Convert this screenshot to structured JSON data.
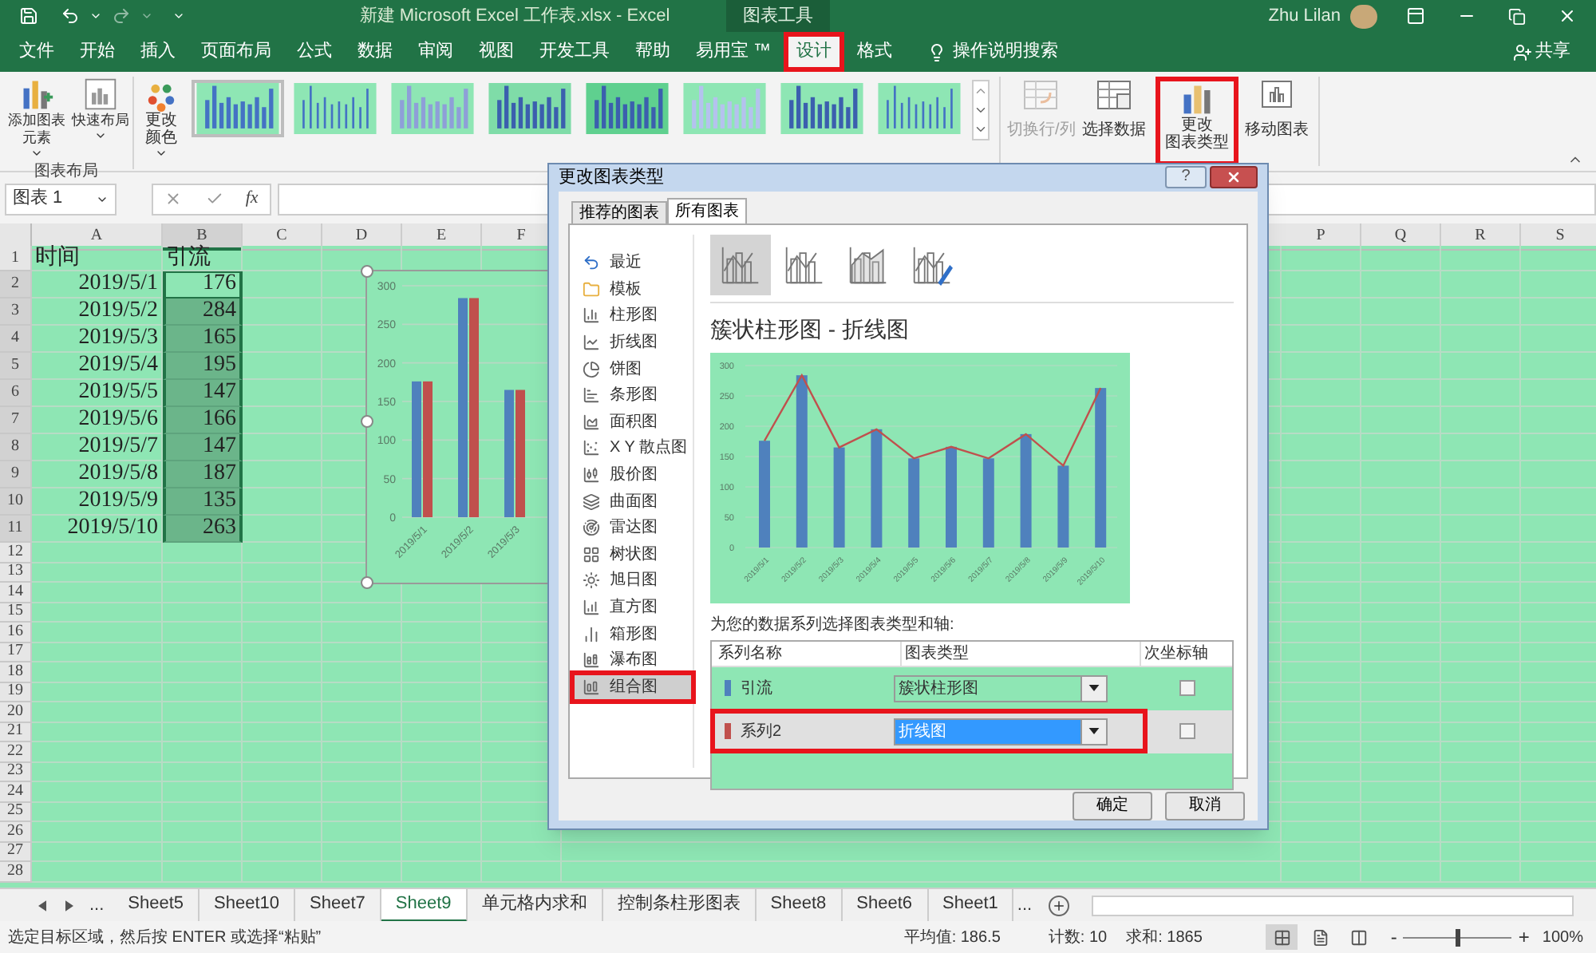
{
  "title_bar": {
    "title": "新建 Microsoft Excel 工作表.xlsx  -  Excel",
    "context": "图表工具",
    "user": "Zhu Lilan"
  },
  "menu": {
    "tabs": [
      {
        "label": "文件",
        "selected": false,
        "annotated": false
      },
      {
        "label": "开始",
        "selected": false,
        "annotated": false
      },
      {
        "label": "插入",
        "selected": false,
        "annotated": false
      },
      {
        "label": "页面布局",
        "selected": false,
        "annotated": false
      },
      {
        "label": "公式",
        "selected": false,
        "annotated": false
      },
      {
        "label": "数据",
        "selected": false,
        "annotated": false
      },
      {
        "label": "审阅",
        "selected": false,
        "annotated": false
      },
      {
        "label": "视图",
        "selected": false,
        "annotated": false
      },
      {
        "label": "开发工具",
        "selected": false,
        "annotated": false
      },
      {
        "label": "帮助",
        "selected": false,
        "annotated": false
      },
      {
        "label": "易用宝 ™",
        "selected": false,
        "annotated": false
      },
      {
        "label": "设计",
        "selected": true,
        "annotated": true
      },
      {
        "label": "格式",
        "selected": false,
        "annotated": false
      }
    ],
    "search": "操作说明搜索",
    "share": "共享"
  },
  "ribbon": {
    "layout_buttons": [
      {
        "lines": [
          "添加图表",
          "元素"
        ],
        "dropdown": true
      },
      {
        "lines": [
          "快速布局"
        ],
        "dropdown": true
      }
    ],
    "layout_group": "图表布局",
    "color_button": {
      "lines": [
        "更改",
        "颜色"
      ],
      "dropdown": true
    },
    "chart_styles": [
      {
        "selected": true
      },
      {
        "selected": false
      },
      {
        "selected": false
      },
      {
        "selected": false
      },
      {
        "selected": false
      },
      {
        "selected": false
      },
      {
        "selected": false
      },
      {
        "selected": false
      }
    ],
    "data_buttons": [
      {
        "label": "切换行/列",
        "disabled": true
      },
      {
        "label": "选择数据",
        "disabled": false
      }
    ],
    "change_type": {
      "lines": [
        "更改",
        "图表类型"
      ],
      "annotated": true
    },
    "move_chart": "移动图表"
  },
  "formula_bar": {
    "name_box": "图表 1",
    "fx": "fx"
  },
  "sheet": {
    "columns_left": [
      {
        "label": "A",
        "selected": false
      },
      {
        "label": "B",
        "selected": true
      },
      {
        "label": "C",
        "selected": false
      },
      {
        "label": "D",
        "selected": false
      },
      {
        "label": "E",
        "selected": false
      },
      {
        "label": "F",
        "selected": false
      }
    ],
    "columns_right": [
      {
        "label": "P",
        "selected": false
      },
      {
        "label": "Q",
        "selected": false
      },
      {
        "label": "R",
        "selected": false
      },
      {
        "label": "S",
        "selected": false
      }
    ],
    "rows": [
      {
        "header": "1",
        "a": "时间",
        "b": "引流",
        "b_selected": false,
        "active": false
      },
      {
        "header": "2",
        "a": "2019/5/1",
        "b": "176",
        "b_selected": true,
        "active": true
      },
      {
        "header": "3",
        "a": "2019/5/2",
        "b": "284",
        "b_selected": true,
        "active": false
      },
      {
        "header": "4",
        "a": "2019/5/3",
        "b": "165",
        "b_selected": true,
        "active": false
      },
      {
        "header": "5",
        "a": "2019/5/4",
        "b": "195",
        "b_selected": true,
        "active": false
      },
      {
        "header": "6",
        "a": "2019/5/5",
        "b": "147",
        "b_selected": true,
        "active": false
      },
      {
        "header": "7",
        "a": "2019/5/6",
        "b": "166",
        "b_selected": true,
        "active": false
      },
      {
        "header": "8",
        "a": "2019/5/7",
        "b": "147",
        "b_selected": true,
        "active": false
      },
      {
        "header": "9",
        "a": "2019/5/8",
        "b": "187",
        "b_selected": true,
        "active": false
      },
      {
        "header": "10",
        "a": "2019/5/9",
        "b": "135",
        "b_selected": true,
        "active": false
      },
      {
        "header": "11",
        "a": "2019/5/10",
        "b": "263",
        "b_selected": true,
        "active": false
      },
      {
        "header": "12",
        "b_selected": false,
        "active": false
      },
      {
        "header": "13",
        "b_selected": false,
        "active": false
      },
      {
        "header": "14",
        "b_selected": false,
        "active": false
      },
      {
        "header": "15",
        "b_selected": false,
        "active": false
      },
      {
        "header": "16",
        "b_selected": false,
        "active": false
      },
      {
        "header": "17",
        "b_selected": false,
        "active": false
      },
      {
        "header": "18",
        "b_selected": false,
        "active": false
      },
      {
        "header": "19",
        "b_selected": false,
        "active": false
      },
      {
        "header": "20",
        "b_selected": false,
        "active": false
      },
      {
        "header": "21",
        "b_selected": false,
        "active": false
      },
      {
        "header": "22",
        "b_selected": false,
        "active": false
      },
      {
        "header": "23",
        "b_selected": false,
        "active": false
      },
      {
        "header": "24",
        "b_selected": false,
        "active": false
      },
      {
        "header": "25",
        "b_selected": false,
        "active": false
      },
      {
        "header": "26",
        "b_selected": false,
        "active": false
      },
      {
        "header": "27",
        "b_selected": false,
        "active": false
      },
      {
        "header": "28",
        "b_selected": false,
        "active": false
      }
    ],
    "chart_data": {
      "type": "bar",
      "grid": true,
      "categories": [
        "2019/5/1",
        "2019/5/2",
        "2019/5/3"
      ],
      "ylim": [
        0,
        300
      ],
      "yticks": [
        0,
        50,
        100,
        150,
        200,
        250,
        300
      ],
      "series": [
        {
          "color": "#4f81bd",
          "values": [
            176,
            284,
            165
          ]
        },
        {
          "color": "#c0504d",
          "values": [
            176,
            284,
            165
          ]
        }
      ]
    }
  },
  "dialog": {
    "title": "更改图表类型",
    "help": "?",
    "tabs": [
      {
        "label": "推荐的图表",
        "selected": false
      },
      {
        "label": "所有图表",
        "selected": true
      }
    ],
    "types": [
      {
        "label": "最近",
        "selected": false,
        "annotated": false
      },
      {
        "label": "模板",
        "selected": false,
        "annotated": false
      },
      {
        "label": "柱形图",
        "selected": false,
        "annotated": false
      },
      {
        "label": "折线图",
        "selected": false,
        "annotated": false
      },
      {
        "label": "饼图",
        "selected": false,
        "annotated": false
      },
      {
        "label": "条形图",
        "selected": false,
        "annotated": false
      },
      {
        "label": "面积图",
        "selected": false,
        "annotated": false
      },
      {
        "label": "X Y 散点图",
        "selected": false,
        "annotated": false
      },
      {
        "label": "股价图",
        "selected": false,
        "annotated": false
      },
      {
        "label": "曲面图",
        "selected": false,
        "annotated": false
      },
      {
        "label": "雷达图",
        "selected": false,
        "annotated": false
      },
      {
        "label": "树状图",
        "selected": false,
        "annotated": false
      },
      {
        "label": "旭日图",
        "selected": false,
        "annotated": false
      },
      {
        "label": "直方图",
        "selected": false,
        "annotated": false
      },
      {
        "label": "箱形图",
        "selected": false,
        "annotated": false
      },
      {
        "label": "瀑布图",
        "selected": false,
        "annotated": false
      },
      {
        "label": "组合图",
        "selected": true,
        "annotated": true
      }
    ],
    "subtypes": [
      {
        "selected": true
      },
      {
        "selected": false
      },
      {
        "selected": false
      },
      {
        "selected": false
      }
    ],
    "heading": "簇状柱形图 - 折线图",
    "chart_data": {
      "type": "bar",
      "grid": true,
      "categories": [
        "2019/5/1",
        "2019/5/2",
        "2019/5/3",
        "2019/5/4",
        "2019/5/5",
        "2019/5/6",
        "2019/5/7",
        "2019/5/8",
        "2019/5/9",
        "2019/5/10"
      ],
      "ylim": [
        0,
        300
      ],
      "yticks": [
        0,
        50,
        100,
        150,
        200,
        250,
        300
      ],
      "series": [
        {
          "color": "#4f81bd",
          "values": [
            176,
            284,
            165,
            195,
            147,
            166,
            147,
            187,
            135,
            263
          ]
        },
        {
          "type": "line",
          "color": "#c0504d",
          "values": [
            176,
            284,
            165,
            195,
            147,
            166,
            147,
            187,
            135,
            263
          ]
        }
      ]
    },
    "series_label": "为您的数据系列选择图表类型和轴:",
    "columns": [
      "系列名称",
      "图表类型",
      "次坐标轴"
    ],
    "series_rows": [
      {
        "name": "引流",
        "color": "#4f81bd",
        "chart_type": "簇状柱形图",
        "selected": false,
        "secondary_axis": false,
        "annotated": false
      },
      {
        "name": "系列2",
        "color": "#c0504d",
        "chart_type": "折线图",
        "selected": true,
        "secondary_axis": false,
        "annotated": true
      }
    ],
    "ok": "确定",
    "cancel": "取消"
  },
  "sheet_tabs": {
    "nav_more": "...",
    "tabs": [
      {
        "label": "Sheet5",
        "selected": false
      },
      {
        "label": "Sheet10",
        "selected": false
      },
      {
        "label": "Sheet7",
        "selected": false
      },
      {
        "label": "Sheet9",
        "selected": true
      },
      {
        "label": "单元格内求和",
        "selected": false
      },
      {
        "label": "控制条柱形图表",
        "selected": false
      },
      {
        "label": "Sheet8",
        "selected": false
      },
      {
        "label": "Sheet6",
        "selected": false
      },
      {
        "label": "Sheet1",
        "selected": false
      }
    ],
    "tabs_more": "..."
  },
  "status_bar": {
    "message": "选定目标区域，然后按 ENTER 或选择“粘贴”",
    "average": "平均值: 186.5",
    "count": "计数: 10",
    "sum": "求和: 1865",
    "views": [
      {
        "selected": true
      },
      {
        "selected": false
      },
      {
        "selected": false
      }
    ],
    "zoom": {
      "minus": "-",
      "plus": "+",
      "level": 0.5,
      "percent": "100%"
    }
  }
}
